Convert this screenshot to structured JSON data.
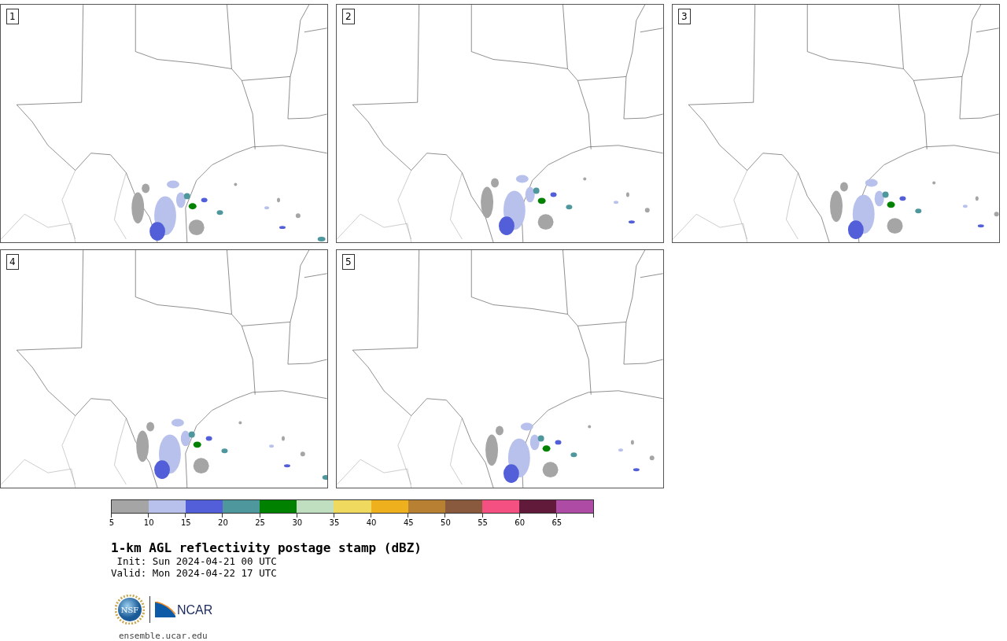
{
  "panels": [
    {
      "label": "1"
    },
    {
      "label": "2"
    },
    {
      "label": "3"
    },
    {
      "label": "4"
    },
    {
      "label": "5"
    }
  ],
  "colorbar": [
    {
      "color": "#a5a5a5",
      "label": "5"
    },
    {
      "color": "#b7c1ec",
      "label": "10"
    },
    {
      "color": "#525fd8",
      "label": "15"
    },
    {
      "color": "#4e979c",
      "label": "20"
    },
    {
      "color": "#008200",
      "label": "25"
    },
    {
      "color": "#bfdfc0",
      "label": "30"
    },
    {
      "color": "#efd95e",
      "label": "35"
    },
    {
      "color": "#efb01d",
      "label": "40"
    },
    {
      "color": "#b88032",
      "label": "45"
    },
    {
      "color": "#8a5a3e",
      "label": "50"
    },
    {
      "color": "#f45081",
      "label": "55"
    },
    {
      "color": "#621a3a",
      "label": "60"
    },
    {
      "color": "#ae4ba5",
      "label": "65"
    }
  ],
  "title": "1-km AGL reflectivity postage stamp (dBZ)",
  "init": " Init: Sun 2024-04-21 00 UTC",
  "valid": "Valid: Mon 2024-04-22 17 UTC",
  "logos": {
    "nsf": "NSF",
    "ncar": "NCAR"
  },
  "url": "ensemble.ucar.edu"
}
